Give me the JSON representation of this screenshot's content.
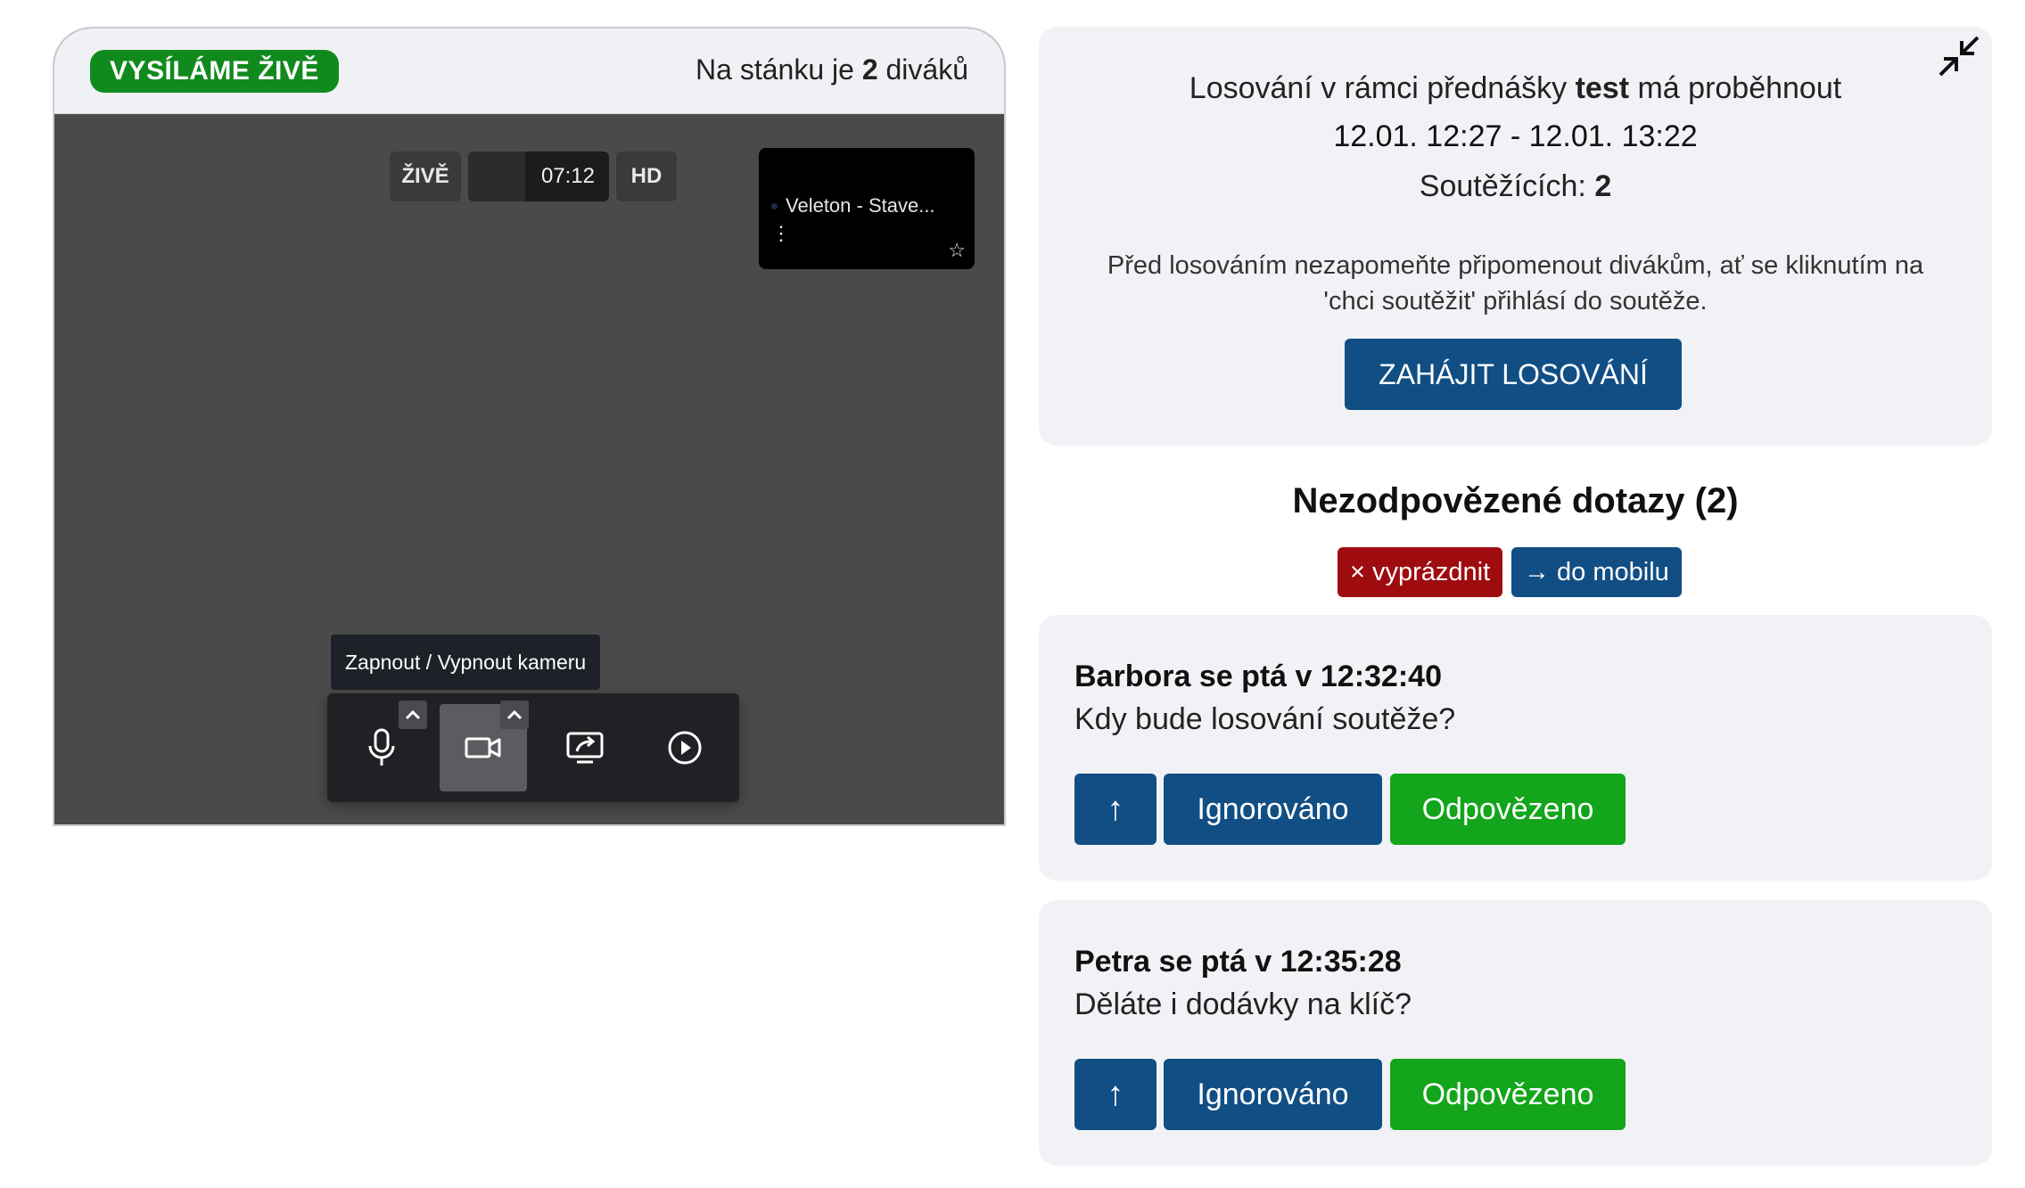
{
  "stream": {
    "live_badge": "VYSÍLÁME ŽIVĚ",
    "viewers_prefix": "Na stánku je ",
    "viewers_count": "2",
    "viewers_suffix": " diváků",
    "player": {
      "live_label": "ŽIVĚ",
      "elapsed": "07:12",
      "quality": "HD",
      "preview_title": "Veleton - Stave..."
    },
    "tooltip": "Zapnout / Vypnout kameru"
  },
  "lottery": {
    "line_prefix": "Losování v rámci přednášky ",
    "lecture_name": "test",
    "line_suffix": " má proběhnout",
    "time_range": "12.01. 12:27 - 12.01. 13:22",
    "competitors_label": "Soutěžících: ",
    "competitors_count": "2",
    "note": "Před losováním nezapomeňte připomenout divákům, ať se kliknutím na 'chci soutěžit' přihlásí do soutěže.",
    "start_button": "ZAHÁJIT LOSOVÁNÍ"
  },
  "questions": {
    "heading": "Nezodpovězené dotazy (2)",
    "clear_button": "× vyprázdnit",
    "mobile_button": "→ do mobilu",
    "items": [
      {
        "title": "Barbora se ptá v 12:32:40",
        "text": "Kdy bude losování soutěže?",
        "up": "↑",
        "ignore": "Ignorováno",
        "answer": "Odpovězeno"
      },
      {
        "title": "Petra se ptá v 12:35:28",
        "text": "Děláte i dodávky na klíč?",
        "up": "↑",
        "ignore": "Ignorováno",
        "answer": "Odpovězeno"
      }
    ]
  },
  "colors": {
    "live_green": "#118a1d",
    "primary_blue": "#114e84",
    "danger_red": "#9e0c10",
    "success_green": "#13a51b",
    "card_bg": "#f1f2f5"
  },
  "icons": [
    "microphone-icon",
    "camera-icon",
    "screen-share-icon",
    "play-circle-icon",
    "collapse-icon",
    "star-icon",
    "more-vertical-icon",
    "chevron-up-icon"
  ]
}
